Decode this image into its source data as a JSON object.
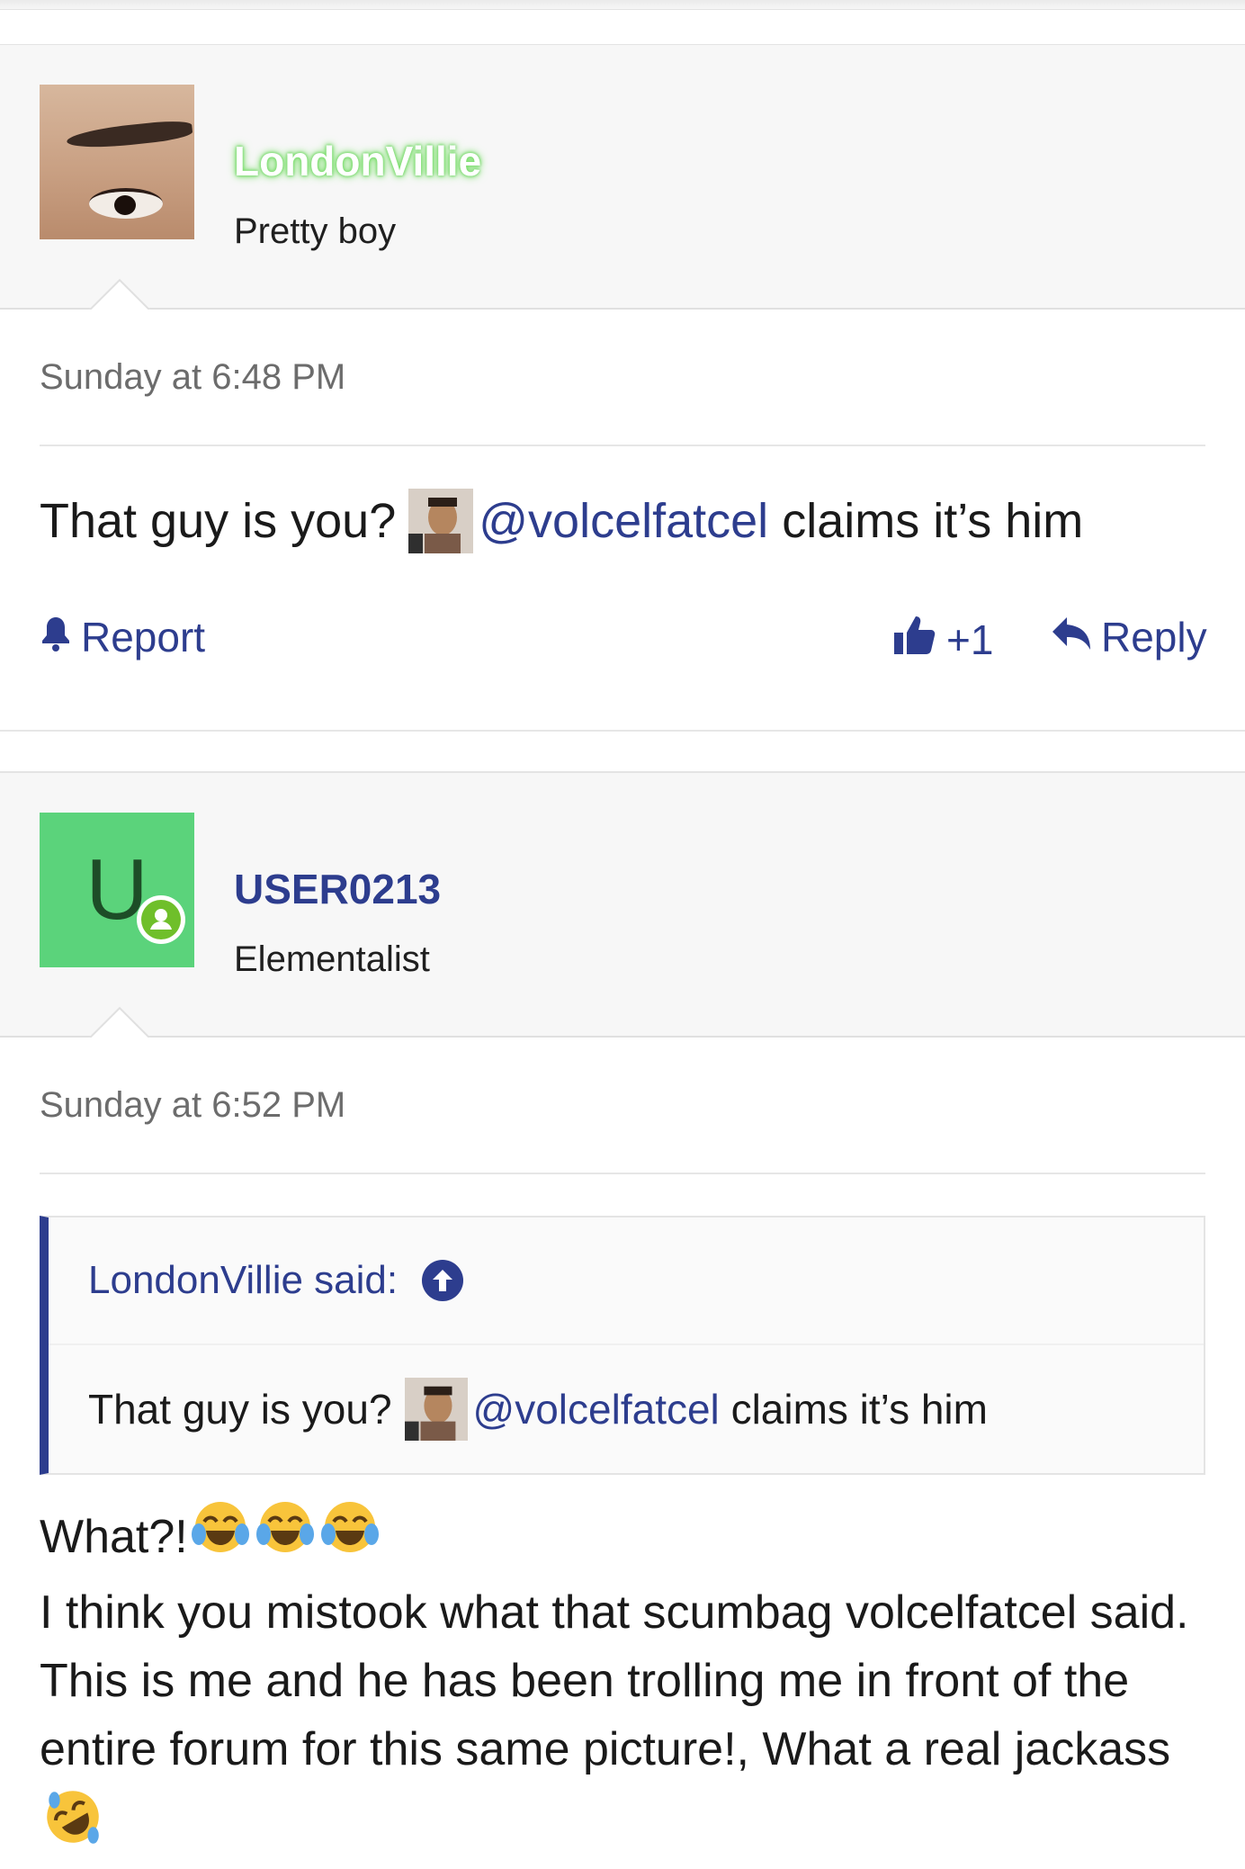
{
  "posts": [
    {
      "username": "LondonVillie",
      "user_title": "Pretty boy",
      "timestamp": "Sunday at 6:48 PM",
      "body": {
        "prefix": "That guy is you?",
        "mention": "@volcelfatcel",
        "suffix": "claims it’s him"
      },
      "actions": {
        "report": "Report",
        "like": "+1",
        "reply": "Reply"
      }
    },
    {
      "username": "USER0213",
      "user_title": "Elementalist",
      "avatar_letter": "U",
      "timestamp": "Sunday at 6:52 PM",
      "quote": {
        "header": "LondonVillie said:",
        "prefix": "That guy is you?",
        "mention": "@volcelfatcel",
        "suffix": "claims it’s him"
      },
      "reply": {
        "line1": "What?!",
        "line2": "I think you mistook what that scumbag volcelfatcel said. This is me and he has been trolling me in front of the entire forum for this same picture!, What a real jackass"
      }
    }
  ],
  "colors": {
    "link_blue": "#2d3d8e",
    "avatar_green": "#5bd37b",
    "online_green": "#6fbf2a",
    "meta_gray": "#6c6c6c"
  },
  "icons": {
    "report": "bell-icon",
    "like": "thumbs-up-icon",
    "reply": "reply-arrow-icon",
    "quote_jump": "arrow-up-circle-icon",
    "online": "user-online-icon",
    "laugh": "tears-of-joy-emoji",
    "rofl": "rolling-laughing-emoji"
  }
}
